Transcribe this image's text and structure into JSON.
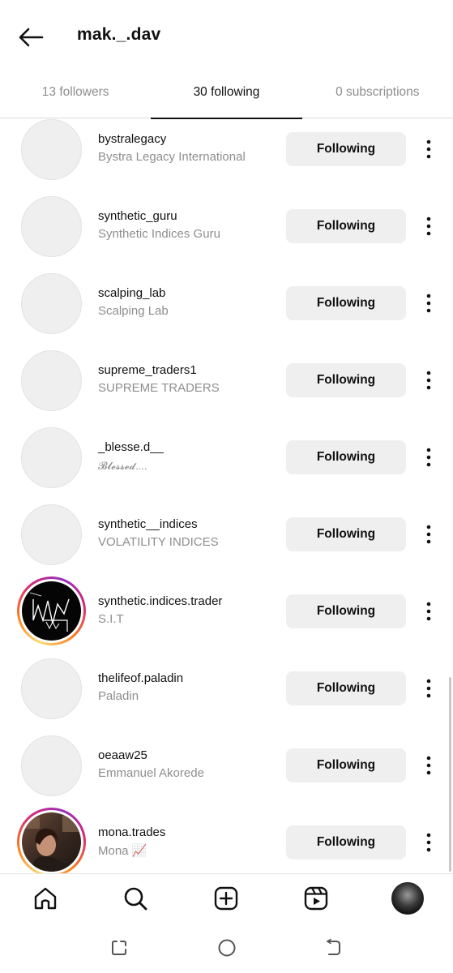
{
  "header": {
    "title": "mak._.dav"
  },
  "tabs": [
    {
      "label": "13 followers",
      "active": false
    },
    {
      "label": "30 following",
      "active": true
    },
    {
      "label": "0 subscriptions",
      "active": false
    }
  ],
  "following": [
    {
      "username": "bystralegacy",
      "name": "Bystra Legacy International",
      "button": "Following",
      "avatar": "placeholder"
    },
    {
      "username": "synthetic_guru",
      "name": "Synthetic Indices  Guru",
      "button": "Following",
      "avatar": "placeholder"
    },
    {
      "username": "scalping_lab",
      "name": "Scalping Lab",
      "button": "Following",
      "avatar": "placeholder"
    },
    {
      "username": "supreme_traders1",
      "name": "SUPREME TRADERS",
      "button": "Following",
      "avatar": "placeholder"
    },
    {
      "username": "_blesse.d__",
      "name": "𝓑𝓵𝓮𝓼𝓼𝓮𝓭....",
      "button": "Following",
      "avatar": "placeholder"
    },
    {
      "username": "synthetic__indices",
      "name": "VOLATILITY INDICES",
      "button": "Following",
      "avatar": "placeholder"
    },
    {
      "username": "synthetic.indices.trader",
      "name": "S.I.T",
      "button": "Following",
      "avatar": "story-logo"
    },
    {
      "username": "thelifeof.paladin",
      "name": "Paladin",
      "button": "Following",
      "avatar": "placeholder"
    },
    {
      "username": "oeaaw25",
      "name": "Emmanuel Akorede",
      "button": "Following",
      "avatar": "placeholder"
    },
    {
      "username": "mona.trades",
      "name": "Mona 📈",
      "button": "Following",
      "avatar": "story-photo"
    }
  ],
  "icons": {
    "back": "arrow-left-icon",
    "more": "more-vertical-icon",
    "home": "home-icon",
    "search": "search-icon",
    "create": "plus-square-icon",
    "reels": "reels-icon",
    "profile": "profile-avatar",
    "recents": "recents-icon",
    "system_home": "circle-home-icon",
    "system_back": "back-icon"
  },
  "colors": {
    "button_bg": "#efefef",
    "secondary_text": "#8e8e8e",
    "story_ring": [
      "#feda75",
      "#fa7e1e",
      "#d62976",
      "#962fbf"
    ]
  }
}
